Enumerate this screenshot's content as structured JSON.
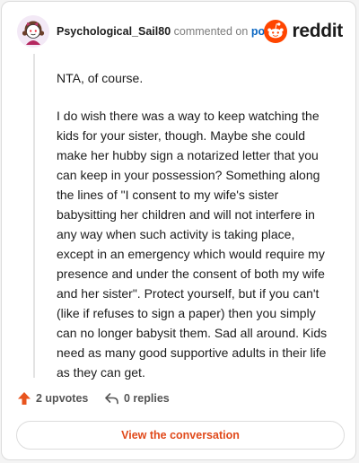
{
  "comment": {
    "username": "Psychological_Sail80",
    "action_text": "commented on",
    "post_link": "post",
    "brand_name": "reddit",
    "paragraphs": [
      "NTA, of course.",
      "I do wish there was a way to keep watching the kids for your sister, though. Maybe she could make her hubby sign a notarized letter that you can keep in your possession? Something along the lines of \"I consent to my wife's sister babysitting her children and will not interfere in any way when such activity is taking place, except in an emergency which would require my presence and under the consent of both my wife and her sister\". Protect yourself, but if you can't (like if refuses to sign a paper) then you simply can no longer babysit them. Sad all around. Kids need as many good supportive adults in their life as they can get."
    ]
  },
  "stats": {
    "upvotes_label": "2 upvotes",
    "replies_label": "0 replies"
  },
  "cta": {
    "label": "View the conversation"
  },
  "colors": {
    "brand_orange": "#ff4500",
    "upvote_orange": "#e8541e",
    "cta_text": "#e0491a",
    "link_blue": "#0a66c2"
  },
  "icons": {
    "avatar": "snoo-avatar",
    "brand": "reddit-snoo-logo",
    "upvote": "arrow-up-icon",
    "reply": "reply-arrow-icon"
  }
}
